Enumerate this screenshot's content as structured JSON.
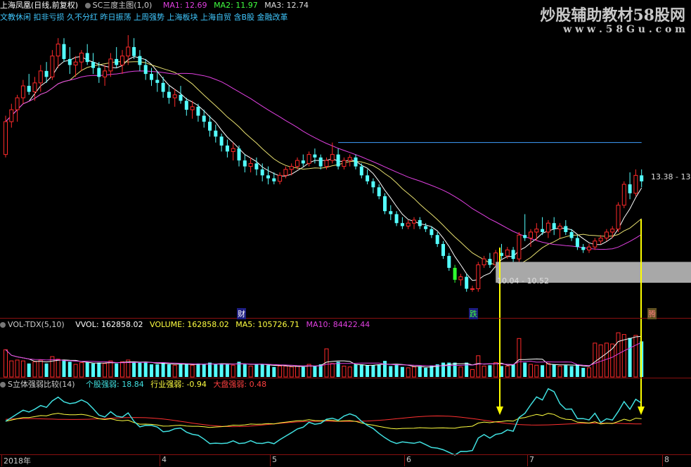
{
  "header": {
    "title": "上海凤凰(日线,前复权)",
    "indicator": "SC三度主图(1,0)",
    "ma1": "MA1: 12.69",
    "ma2": "MA2: 11.97",
    "ma3": "MA3: 12.74",
    "concepts": "文教休闲 扣非亏损 久不分红 昨日振荡 上周强势 上海板块 上海自贸 含B股 金融改革"
  },
  "watermark": {
    "line1": "炒股辅助教材58股网",
    "line2": "w w w . 5 8 G u . c o m"
  },
  "labels": {
    "range_high": "13.38 - 13.",
    "range_low": "10.04 - 10.52",
    "mark_cai": "财",
    "mark_die": "跌",
    "mark_teng": "腾"
  },
  "volume_header": {
    "name": "VOL-TDX(5,10)",
    "vvol": "VVOL: 162858.02",
    "volume": "VOLUME: 162858.02",
    "ma5": "MA5: 105726.71",
    "ma10": "MA10: 84422.44"
  },
  "strength_header": {
    "name": "S立体强弱比较(14)",
    "stock": "个股强弱: 18.84",
    "industry": "行业强弱: -0.94",
    "market": "大盘强弱: 0.48"
  },
  "x_axis": [
    "2018年",
    "4",
    "5",
    "6",
    "7",
    "8"
  ],
  "colors": {
    "up": "#ff2a2a",
    "down": "#54ffff",
    "ma1": "#ffffff",
    "ma2": "#e8e070",
    "ma3": "#e040e0",
    "yellow": "#ffff00"
  },
  "chart_data": {
    "type": "candlestick",
    "ohlc": [
      [
        13.9,
        15.2,
        13.8,
        15.0
      ],
      [
        15.0,
        15.6,
        14.8,
        15.4
      ],
      [
        15.4,
        15.9,
        15.0,
        15.8
      ],
      [
        15.8,
        16.4,
        15.6,
        16.2
      ],
      [
        16.2,
        16.6,
        15.9,
        16.0
      ],
      [
        16.0,
        16.5,
        15.7,
        16.3
      ],
      [
        16.3,
        16.9,
        16.0,
        16.7
      ],
      [
        16.7,
        17.0,
        16.3,
        16.5
      ],
      [
        16.5,
        17.4,
        16.4,
        17.2
      ],
      [
        17.2,
        17.8,
        16.8,
        17.6
      ],
      [
        17.6,
        17.8,
        17.0,
        17.1
      ],
      [
        17.1,
        17.5,
        16.6,
        16.9
      ],
      [
        16.9,
        17.2,
        16.5,
        17.0
      ],
      [
        17.0,
        17.4,
        16.7,
        17.3
      ],
      [
        17.3,
        17.6,
        16.9,
        17.0
      ],
      [
        17.0,
        17.3,
        16.6,
        16.8
      ],
      [
        16.8,
        17.0,
        16.3,
        16.5
      ],
      [
        16.5,
        16.9,
        16.2,
        16.7
      ],
      [
        16.7,
        17.3,
        16.5,
        17.1
      ],
      [
        17.1,
        17.5,
        16.8,
        16.9
      ],
      [
        16.9,
        17.4,
        16.6,
        17.2
      ],
      [
        17.2,
        17.9,
        16.9,
        17.5
      ],
      [
        17.5,
        17.8,
        17.1,
        17.2
      ],
      [
        17.2,
        17.4,
        16.7,
        16.9
      ],
      [
        16.9,
        17.1,
        16.4,
        16.6
      ],
      [
        16.6,
        16.8,
        16.2,
        16.4
      ],
      [
        16.4,
        16.7,
        16.0,
        16.3
      ],
      [
        16.3,
        16.5,
        15.8,
        16.0
      ],
      [
        16.0,
        16.2,
        15.6,
        15.8
      ],
      [
        15.8,
        16.1,
        15.5,
        15.9
      ],
      [
        15.9,
        16.2,
        15.6,
        15.7
      ],
      [
        15.7,
        15.8,
        15.2,
        15.4
      ],
      [
        15.4,
        15.7,
        15.1,
        15.5
      ],
      [
        15.5,
        15.6,
        15.0,
        15.2
      ],
      [
        15.2,
        15.4,
        14.8,
        15.0
      ],
      [
        15.0,
        15.2,
        14.5,
        14.7
      ],
      [
        14.7,
        14.9,
        14.3,
        14.5
      ],
      [
        14.5,
        14.6,
        14.0,
        14.2
      ],
      [
        14.2,
        14.4,
        13.8,
        14.0
      ],
      [
        14.0,
        14.3,
        13.7,
        14.1
      ],
      [
        14.1,
        14.2,
        13.5,
        13.7
      ],
      [
        13.7,
        13.9,
        13.3,
        13.5
      ],
      [
        13.5,
        13.8,
        13.3,
        13.6
      ],
      [
        13.6,
        13.8,
        13.2,
        13.4
      ],
      [
        13.4,
        13.6,
        13.0,
        13.2
      ],
      [
        13.2,
        13.5,
        12.9,
        13.1
      ],
      [
        13.1,
        13.3,
        12.9,
        13.0
      ],
      [
        13.0,
        13.3,
        12.9,
        13.2
      ],
      [
        13.2,
        13.5,
        13.1,
        13.4
      ],
      [
        13.4,
        13.6,
        13.2,
        13.5
      ],
      [
        13.5,
        13.8,
        13.4,
        13.7
      ],
      [
        13.7,
        13.9,
        13.5,
        13.6
      ],
      [
        13.6,
        14.0,
        13.5,
        13.9
      ],
      [
        13.9,
        14.1,
        13.6,
        13.8
      ],
      [
        13.8,
        13.9,
        13.4,
        13.5
      ],
      [
        13.5,
        13.8,
        13.4,
        13.7
      ],
      [
        13.7,
        14.3,
        13.6,
        13.9
      ],
      [
        13.9,
        14.1,
        13.4,
        13.5
      ],
      [
        13.5,
        13.8,
        13.4,
        13.7
      ],
      [
        13.7,
        13.9,
        13.5,
        13.8
      ],
      [
        13.8,
        13.9,
        13.4,
        13.5
      ],
      [
        13.5,
        13.6,
        13.1,
        13.2
      ],
      [
        13.2,
        13.4,
        12.9,
        13.0
      ],
      [
        13.0,
        13.1,
        12.6,
        12.8
      ],
      [
        12.8,
        12.9,
        12.4,
        12.5
      ],
      [
        12.5,
        12.6,
        11.9,
        12.0
      ],
      [
        12.0,
        12.2,
        11.7,
        11.9
      ],
      [
        11.9,
        12.0,
        11.5,
        11.6
      ],
      [
        11.6,
        11.8,
        11.4,
        11.5
      ],
      [
        11.5,
        11.7,
        11.4,
        11.6
      ],
      [
        11.6,
        11.8,
        11.4,
        11.7
      ],
      [
        11.7,
        11.8,
        11.4,
        11.5
      ],
      [
        11.5,
        11.6,
        11.3,
        11.4
      ],
      [
        11.4,
        11.5,
        11.1,
        11.2
      ],
      [
        11.2,
        11.3,
        10.8,
        10.9
      ],
      [
        10.9,
        11.0,
        10.4,
        10.5
      ],
      [
        10.5,
        10.6,
        10.0,
        10.1
      ],
      [
        10.1,
        10.2,
        9.6,
        9.7
      ],
      [
        9.7,
        9.9,
        9.5,
        9.8
      ],
      [
        9.8,
        9.9,
        9.3,
        9.4
      ],
      [
        9.4,
        9.5,
        9.3,
        9.4
      ],
      [
        9.4,
        10.3,
        9.3,
        10.2
      ],
      [
        10.2,
        10.5,
        10.1,
        10.4
      ],
      [
        10.4,
        10.6,
        10.1,
        10.2
      ],
      [
        10.2,
        10.7,
        10.1,
        10.6
      ],
      [
        10.6,
        10.9,
        10.4,
        10.5
      ],
      [
        10.5,
        10.8,
        10.4,
        10.7
      ],
      [
        10.7,
        10.8,
        10.3,
        10.4
      ],
      [
        10.4,
        11.3,
        10.3,
        11.2
      ],
      [
        11.2,
        11.9,
        11.0,
        11.1
      ],
      [
        11.1,
        11.4,
        10.8,
        11.3
      ],
      [
        11.3,
        11.6,
        11.0,
        11.4
      ],
      [
        11.4,
        11.8,
        11.2,
        11.3
      ],
      [
        11.3,
        11.7,
        11.1,
        11.6
      ],
      [
        11.6,
        11.8,
        11.2,
        11.4
      ],
      [
        11.4,
        11.6,
        11.1,
        11.5
      ],
      [
        11.5,
        11.7,
        11.2,
        11.3
      ],
      [
        11.3,
        11.4,
        11.0,
        11.1
      ],
      [
        11.1,
        11.2,
        10.7,
        10.8
      ],
      [
        10.8,
        10.9,
        10.6,
        10.7
      ],
      [
        10.7,
        10.9,
        10.6,
        10.8
      ],
      [
        10.8,
        11.1,
        10.7,
        11.0
      ],
      [
        11.0,
        11.2,
        10.9,
        11.1
      ],
      [
        11.1,
        11.4,
        11.0,
        11.3
      ],
      [
        11.3,
        11.5,
        11.1,
        11.4
      ],
      [
        11.4,
        12.3,
        11.3,
        12.2
      ],
      [
        12.2,
        13.0,
        12.1,
        12.9
      ],
      [
        12.9,
        13.3,
        12.4,
        12.6
      ],
      [
        12.6,
        13.4,
        12.5,
        13.2
      ],
      [
        13.2,
        13.4,
        12.8,
        13.0
      ]
    ],
    "ma_names": [
      "MA1",
      "MA2",
      "MA3"
    ],
    "volume_names": [
      "VOLUME",
      "MA5",
      "MA10"
    ],
    "strength_names": [
      "个股强弱",
      "行业强弱",
      "大盘强弱"
    ]
  }
}
